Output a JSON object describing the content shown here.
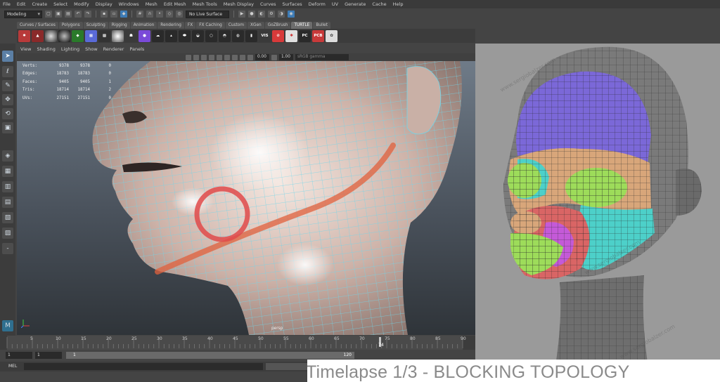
{
  "menubar": {
    "items": [
      "File",
      "Edit",
      "Create",
      "Select",
      "Modify",
      "Display",
      "Windows",
      "Mesh",
      "Edit Mesh",
      "Mesh Tools",
      "Mesh Display",
      "Curves",
      "Surfaces",
      "Deform",
      "UV",
      "Generate",
      "Cache",
      "Help"
    ]
  },
  "statusline": {
    "mode": "Modeling",
    "live_surface": "No Live Surface"
  },
  "shelf": {
    "tabs": [
      "Curves / Surfaces",
      "Polygons",
      "Sculpting",
      "Rigging",
      "Animation",
      "Rendering",
      "FX",
      "FX Caching",
      "Custom",
      "XGen",
      "GoZBrush",
      "TURTLE",
      "Bullet"
    ],
    "active_tab": "TURTLE",
    "button_labels": {
      "vis": "VIS",
      "pc": "PC",
      "pcb": "PCB"
    }
  },
  "viewport": {
    "menu": [
      "View",
      "Shading",
      "Lighting",
      "Show",
      "Renderer",
      "Panels"
    ],
    "field_a": "0.00",
    "field_b": "1.00",
    "color_space": "sRGB gamma",
    "camera_label": "persp",
    "hud": [
      {
        "label": "Verts:",
        "a": "9378",
        "b": "9378",
        "c": "0"
      },
      {
        "label": "Edges:",
        "a": "18783",
        "b": "18783",
        "c": "0"
      },
      {
        "label": "Faces:",
        "a": "9405",
        "b": "9405",
        "c": "1"
      },
      {
        "label": "Tris:",
        "a": "18714",
        "b": "18714",
        "c": "2"
      },
      {
        "label": "UVs:",
        "a": "27151",
        "b": "27151",
        "c": "0"
      }
    ]
  },
  "timeline": {
    "ticks": [
      "5",
      "10",
      "15",
      "20",
      "25",
      "30",
      "35",
      "40",
      "45",
      "50",
      "55",
      "60",
      "65",
      "70",
      "75",
      "80",
      "85",
      "90"
    ],
    "current_frame": "74",
    "start_a": "1",
    "start_b": "1",
    "range_start": "1",
    "range_end": "120"
  },
  "command_line": {
    "label": "MEL"
  },
  "reference": {
    "watermark": "www.sergiobalzer.com",
    "colors": {
      "forehead": "#7b68d8",
      "cheek": "#4dd0c9",
      "eye": "#9ddc5a",
      "mask": "#d8a67a",
      "mouth_loop": "#d96565",
      "lips": "#9ddc5a",
      "nose_loop": "#c45ad8"
    }
  },
  "caption": "Timelapse 1/3 - BLOCKING TOPOLOGY"
}
